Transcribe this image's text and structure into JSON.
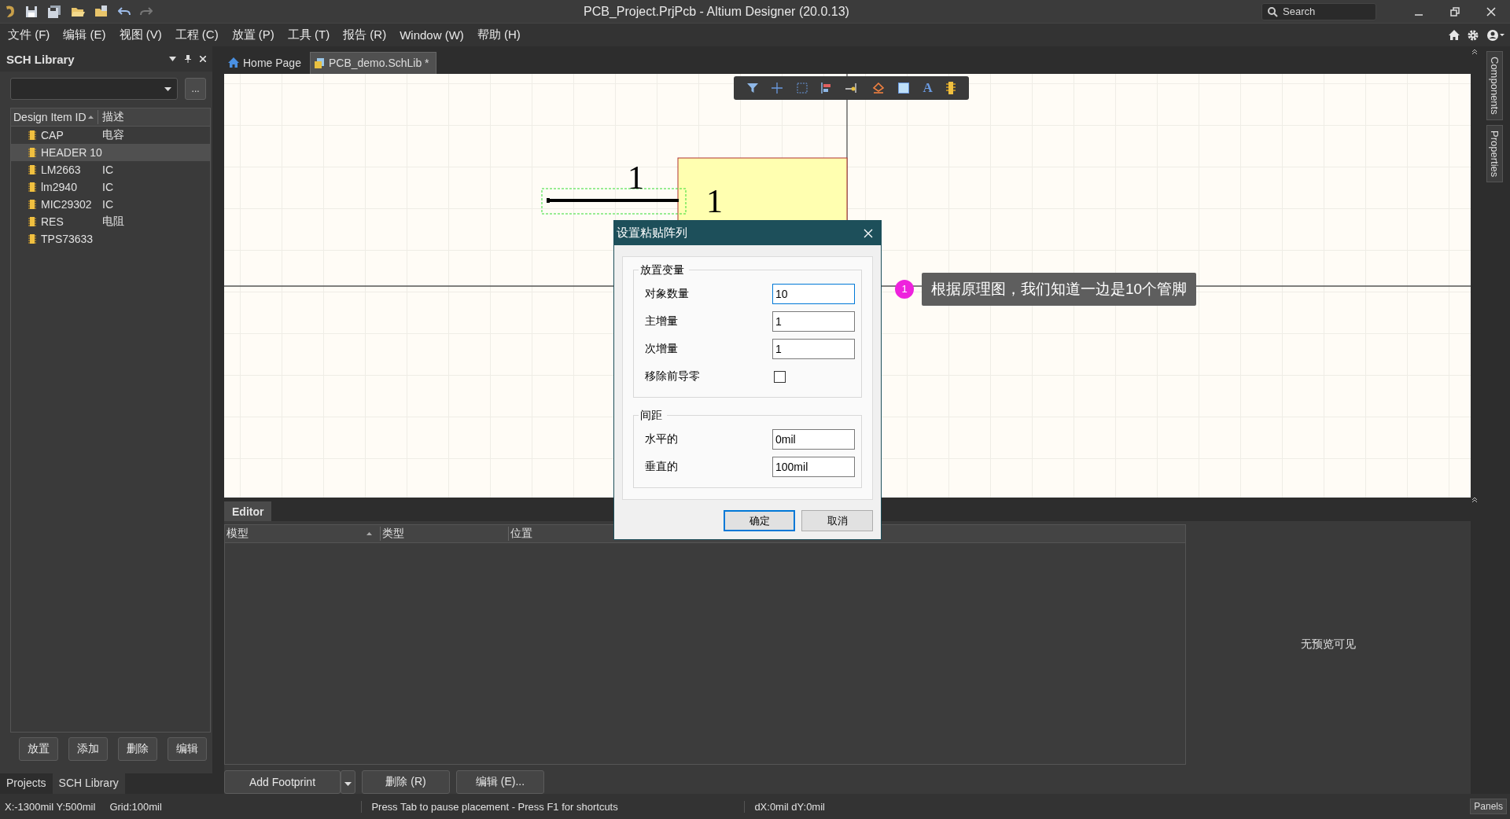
{
  "window": {
    "title": "PCB_Project.PrjPcb - Altium Designer (20.0.13)",
    "search_placeholder": "Search"
  },
  "menu": [
    "文件 (F)",
    "编辑 (E)",
    "视图 (V)",
    "工程 (C)",
    "放置 (P)",
    "工具 (T)",
    "报告 (R)",
    "Window (W)",
    "帮助 (H)"
  ],
  "library_panel": {
    "title": "SCH Library",
    "more_button": "...",
    "columns": [
      "Design Item ID",
      "描述"
    ],
    "rows": [
      {
        "id": "CAP",
        "description": "电容",
        "selected": false
      },
      {
        "id": "HEADER 10",
        "description": "",
        "selected": true
      },
      {
        "id": "LM2663",
        "description": "IC",
        "selected": false
      },
      {
        "id": "lm2940",
        "description": "IC",
        "selected": false
      },
      {
        "id": "MIC29302",
        "description": "IC",
        "selected": false
      },
      {
        "id": "RES",
        "description": "电阻",
        "selected": false
      },
      {
        "id": "TPS73633",
        "description": "",
        "selected": false
      }
    ],
    "buttons": [
      "放置",
      "添加",
      "删除",
      "编辑"
    ],
    "tabs": [
      {
        "label": "Projects",
        "selected": false
      },
      {
        "label": "SCH Library",
        "selected": true
      }
    ]
  },
  "doc_tabs": [
    {
      "label": "Home Page",
      "kind": "home",
      "selected": false
    },
    {
      "label": "PCB_demo.SchLib *",
      "kind": "schlib",
      "selected": true
    }
  ],
  "canvas": {
    "pin_number": "1",
    "pin_designator": "1",
    "text_tool_glyph": "A"
  },
  "right_tabs": [
    "Components",
    "Properties"
  ],
  "callout": {
    "badge": "1",
    "text": "根据原理图，我们知道一边是10个管脚"
  },
  "dialog": {
    "title": "设置粘贴阵列",
    "sections": [
      {
        "title": "放置变量",
        "fields": [
          {
            "label": "对象数量",
            "kind": "input",
            "value": "10",
            "focused": true
          },
          {
            "label": "主增量",
            "kind": "input",
            "value": "1",
            "focused": false
          },
          {
            "label": "次增量",
            "kind": "input",
            "value": "1",
            "focused": false
          },
          {
            "label": "移除前导零",
            "kind": "checkbox",
            "checked": false
          }
        ]
      },
      {
        "title": "间距",
        "fields": [
          {
            "label": "水平的",
            "kind": "input",
            "value": "0mil",
            "focused": false
          },
          {
            "label": "垂直的",
            "kind": "input",
            "value": "100mil",
            "focused": false
          }
        ]
      }
    ],
    "buttons": [
      {
        "label": "确定",
        "default": true
      },
      {
        "label": "取消",
        "default": false
      }
    ]
  },
  "editor": {
    "tab": "Editor",
    "columns": [
      "模型",
      "类型",
      "位置"
    ],
    "preview": "无预览可见",
    "add_button": "Add Footprint",
    "buttons": [
      "删除 (R)",
      "编辑 (E)..."
    ]
  },
  "status_bar": {
    "position": "X:-1300mil Y:500mil",
    "grid": "Grid:100mil",
    "hint": "Press Tab to pause placement - Press F1 for shortcuts",
    "delta": "dX:0mil dY:0mil",
    "panels": "Panels"
  }
}
